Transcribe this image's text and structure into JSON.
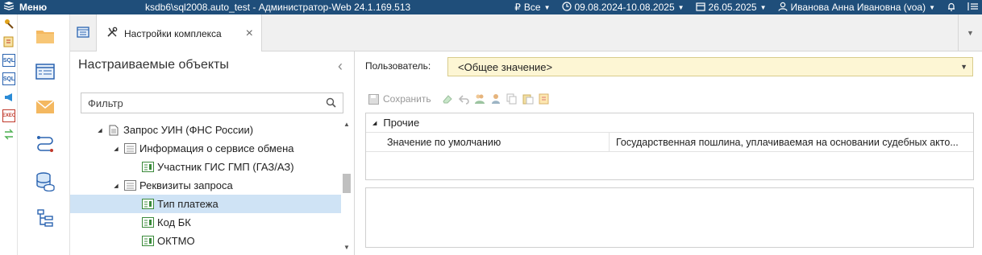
{
  "titlebar": {
    "menu_label": "Меню",
    "app_title": "ksdb6\\sql2008.auto_test - Администратор-Web 24.1.169.513",
    "budget_label": "Все",
    "period": "09.08.2024-10.08.2025",
    "date": "26.05.2025",
    "user": "Иванова Анна Ивановна (voa)"
  },
  "tabs": {
    "active_label": "Настройки комплекса",
    "close_glyph": "×"
  },
  "tree_panel": {
    "title": "Настраиваемые объекты",
    "filter_placeholder": "Фильтр",
    "items": [
      {
        "label": "Запрос УИН (ФНС России)",
        "level": 0,
        "expanded": true,
        "selected": false
      },
      {
        "label": "Информация о сервисе обмена",
        "level": 1,
        "expanded": true,
        "selected": false
      },
      {
        "label": "Участник ГИС ГМП (ГАЗ/АЗ)",
        "level": 2,
        "expanded": false,
        "selected": false
      },
      {
        "label": "Реквизиты запроса",
        "level": 1,
        "expanded": true,
        "selected": false
      },
      {
        "label": "Тип платежа",
        "level": 2,
        "expanded": false,
        "selected": true
      },
      {
        "label": "Код БК",
        "level": 2,
        "expanded": false,
        "selected": false
      },
      {
        "label": "ОКТМО",
        "level": 2,
        "expanded": false,
        "selected": false
      }
    ]
  },
  "right_panel": {
    "user_label": "Пользователь:",
    "user_value": "<Общее значение>",
    "save_label": "Сохранить",
    "group_label": "Прочие",
    "property_key": "Значение по умолчанию",
    "property_value": "Государственная пошлина, уплачиваемая на основании судебных акто..."
  },
  "colors": {
    "titlebar_bg": "#1f4e7a",
    "selection_bg": "#cfe3f5",
    "user_select_bg": "#fdf6d4"
  }
}
